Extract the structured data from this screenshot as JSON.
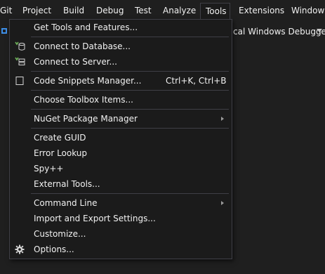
{
  "menubar": {
    "items": [
      {
        "label": "Git",
        "active": false
      },
      {
        "label": "Project",
        "active": false
      },
      {
        "label": "Build",
        "active": false
      },
      {
        "label": "Debug",
        "active": false
      },
      {
        "label": "Test",
        "active": false
      },
      {
        "label": "Analyze",
        "active": false
      },
      {
        "label": "Tools",
        "active": true
      },
      {
        "label": "Extensions",
        "active": false
      },
      {
        "label": "Window",
        "active": false
      }
    ]
  },
  "toolbar": {
    "debugger_label": "cal Windows Debugger"
  },
  "tools_menu": {
    "items": [
      {
        "label": "Get Tools and Features...",
        "icon": null
      },
      {
        "label": "Connect to Database...",
        "icon": "database-connect-icon"
      },
      {
        "label": "Connect to Server...",
        "icon": "server-connect-icon"
      },
      {
        "label": "Code Snippets Manager...",
        "shortcut": "Ctrl+K, Ctrl+B",
        "icon": "snippet-icon"
      },
      {
        "label": "Choose Toolbox Items...",
        "icon": null
      },
      {
        "label": "NuGet Package Manager",
        "submenu": true,
        "icon": null
      },
      {
        "label": "Create GUID",
        "icon": null
      },
      {
        "label": "Error Lookup",
        "icon": null
      },
      {
        "label": "Spy++",
        "icon": null
      },
      {
        "label": "External Tools...",
        "icon": null
      },
      {
        "label": "Command Line",
        "submenu": true,
        "icon": null
      },
      {
        "label": "Import and Export Settings...",
        "icon": null
      },
      {
        "label": "Customize...",
        "icon": null
      },
      {
        "label": "Options...",
        "icon": "gear-icon"
      }
    ]
  },
  "colors": {
    "background": "#1f1f1f",
    "menu_background": "#1b1b1b",
    "menu_border": "#3f3f46",
    "text": "#f1f1f1",
    "icon_green": "#6fb35a",
    "icon_blue": "#3d8ee6"
  }
}
